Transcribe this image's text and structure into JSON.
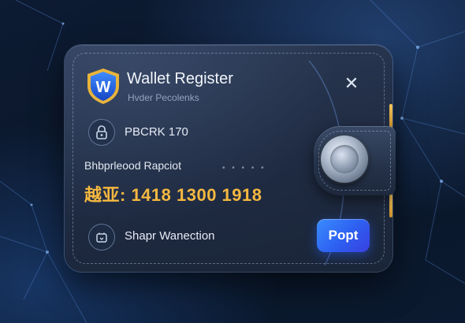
{
  "dialog": {
    "title": "Wallet Register",
    "subtitle": "Hvder Pecolenks",
    "shield_letter": "W",
    "close_icon": "✕",
    "account_code": "PBCRK 170",
    "address_label": "Bhbprleood Rapciot",
    "balance": "越亚: 1418  1300  1918",
    "action_label": "Shapr Wanection",
    "accept_button": "Popt"
  },
  "icons": {
    "shield": "shield-icon",
    "close": "close-icon",
    "lock": "lock-icon",
    "wallet": "wallet-icon",
    "clasp": "clasp-icon"
  },
  "colors": {
    "accent": "#2d5ff0",
    "balance": "#f5b840",
    "shield_blue": "#1e5fe0",
    "shield_gold": "#e8b43c"
  }
}
